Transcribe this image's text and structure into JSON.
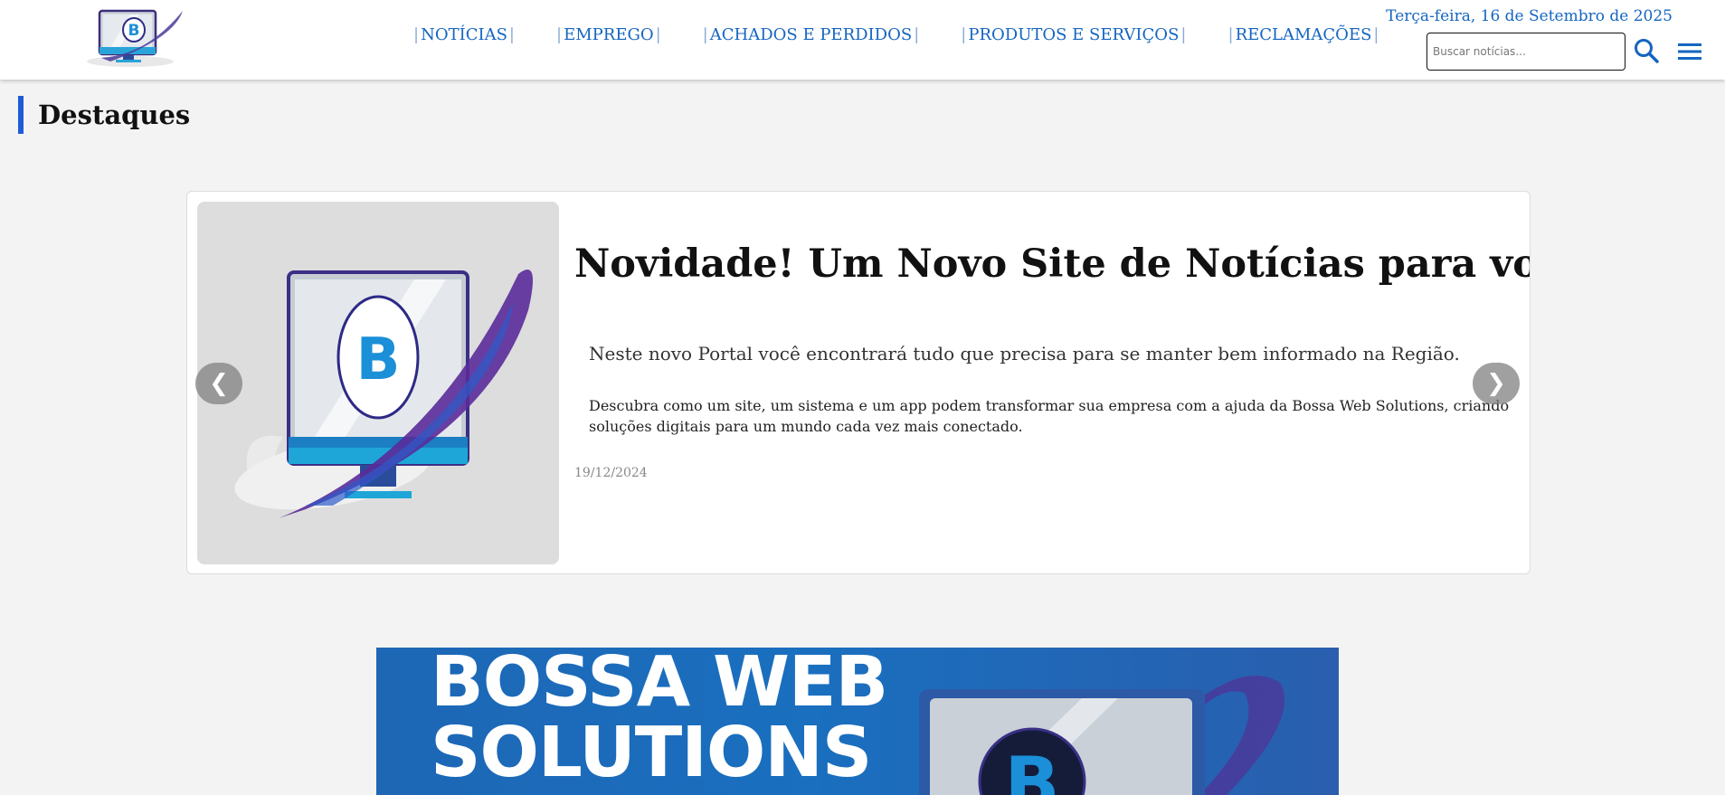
{
  "header": {
    "logo_name": "bossa-logo",
    "date": "Terça-feira, 16 de Setembro de 2025",
    "nav": [
      {
        "label": "NOTÍCIAS"
      },
      {
        "label": "EMPREGO"
      },
      {
        "label": "ACHADOS E PERDIDOS"
      },
      {
        "label": "PRODUTOS E SERVIÇOS"
      },
      {
        "label": "RECLAMAÇÕES"
      }
    ],
    "search": {
      "placeholder": "Buscar notícias..."
    },
    "search_icon": "search-icon",
    "menu_icon": "hamburger-menu-icon"
  },
  "section": {
    "title": "Destaques"
  },
  "carousel": {
    "slide": {
      "title": "Novidade! Um Novo Site de Notícias para você!",
      "lead": "Neste novo Portal você encontrará tudo que precisa para se manter bem informado na Região.",
      "body": "Descubra como um site, um sistema e um app podem transformar sua empresa com a ajuda da Bossa Web Solutions, criando soluções digitais para um mundo cada vez mais conectado.",
      "date": "19/12/2024"
    },
    "prev_label": "❮",
    "next_label": "❯"
  },
  "banner": {
    "line1": "BOSSA WEB",
    "line2": "SOLUTIONS"
  },
  "colors": {
    "accent": "#1565c0",
    "section_bar": "#1e5bd8",
    "banner_bg": "#1d67b5"
  }
}
